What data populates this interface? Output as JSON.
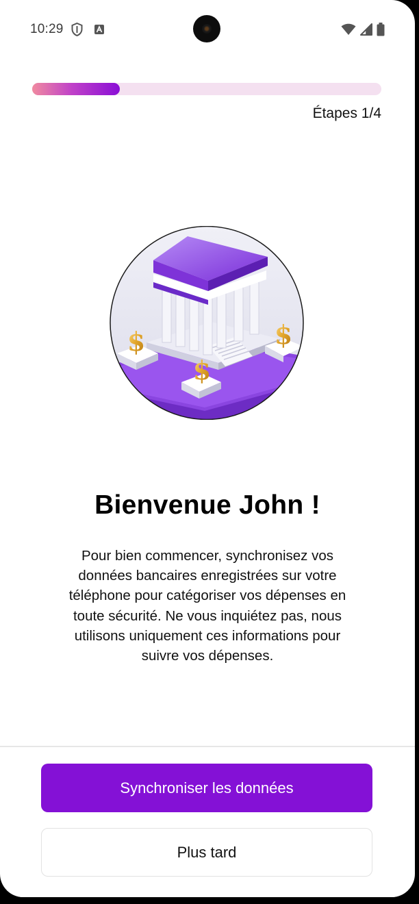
{
  "status_bar": {
    "time": "10:29",
    "icons_left": [
      "shield-icon",
      "keyboard-a-icon"
    ],
    "icons_right": [
      "wifi-icon",
      "signal-icon",
      "battery-icon"
    ]
  },
  "progress": {
    "value": 0.25,
    "label": "Étapes 1/4",
    "colors": {
      "track": "#f4e0f0",
      "start": "#f08aa0",
      "end": "#8a0ed6"
    }
  },
  "illustration": {
    "icon": "bank-with-dollar-icon"
  },
  "content": {
    "title": "Bienvenue John !",
    "description_lines": [
      "Pour bien commencer, synchronisez vos",
      "données bancaires enregistrées sur votre",
      "téléphone pour catégoriser vos dépenses en",
      "toute sécurité. Ne vous inquiétez pas, nous",
      "utilisons uniquement ces informations pour",
      "suivre vos dépenses."
    ]
  },
  "actions": {
    "primary_label": "Synchroniser les données",
    "secondary_label": "Plus tard",
    "primary_color": "#8411d6"
  }
}
